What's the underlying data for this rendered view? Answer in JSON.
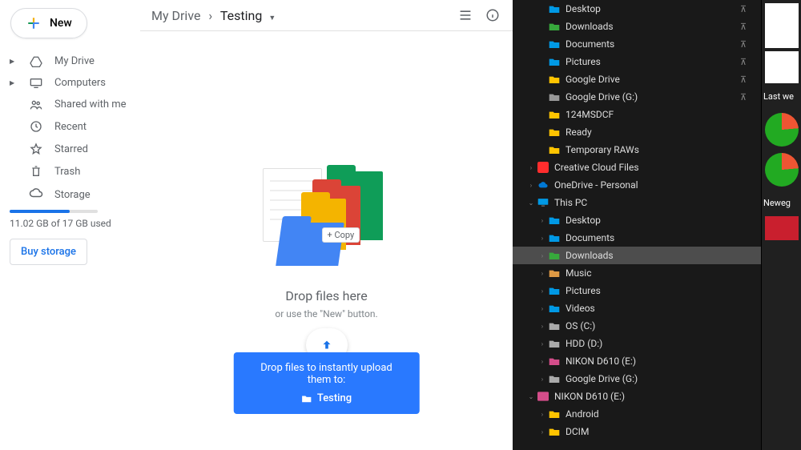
{
  "drive": {
    "new_label": "New",
    "nav": {
      "mydrive": "My Drive",
      "computers": "Computers",
      "shared": "Shared with me",
      "recent": "Recent",
      "starred": "Starred",
      "trash": "Trash"
    },
    "storage": {
      "label": "Storage",
      "used": "11.02 GB of 17 GB used",
      "buy": "Buy storage"
    },
    "breadcrumb": {
      "root": "My Drive",
      "current": "Testing"
    },
    "copy_badge": "+ Copy",
    "drop_title": "Drop files here",
    "drop_sub": "or use the \"New\" button.",
    "toast": {
      "line1": "Drop files to instantly upload them to:",
      "folder": "Testing"
    }
  },
  "explorer": {
    "quick": [
      {
        "label": "Desktop",
        "icon": "#0099e5"
      },
      {
        "label": "Downloads",
        "icon": "#37a93c"
      },
      {
        "label": "Documents",
        "icon": "#0099e5"
      },
      {
        "label": "Pictures",
        "icon": "#0099e5"
      },
      {
        "label": "Google Drive",
        "icon": "#ffc400"
      },
      {
        "label": "Google Drive (G:)",
        "icon": "#999"
      },
      {
        "label": "124MSDCF",
        "icon": "#ffc400"
      },
      {
        "label": "Ready",
        "icon": "#ffc400"
      },
      {
        "label": "Temporary RAWs",
        "icon": "#ffc400"
      }
    ],
    "creative": "Creative Cloud Files",
    "onedrive": "OneDrive - Personal",
    "thispc": "This PC",
    "pc": [
      {
        "label": "Desktop",
        "icon": "#0099e5"
      },
      {
        "label": "Documents",
        "icon": "#0099e5"
      },
      {
        "label": "Downloads",
        "icon": "#37a93c",
        "sel": true
      },
      {
        "label": "Music",
        "icon": "#d94"
      },
      {
        "label": "Pictures",
        "icon": "#0099e5"
      },
      {
        "label": "Videos",
        "icon": "#0099e5"
      },
      {
        "label": "OS (C:)",
        "icon": "#aaa"
      },
      {
        "label": "HDD (D:)",
        "icon": "#aaa"
      },
      {
        "label": "NIKON D610  (E:)",
        "icon": "#d44d8a"
      },
      {
        "label": "Google Drive (G:)",
        "icon": "#aaa"
      }
    ],
    "nikon": "NIKON D610  (E:)",
    "nikon_items": [
      {
        "label": "Android",
        "icon": "#ffc400"
      },
      {
        "label": "DCIM",
        "icon": "#ffc400"
      }
    ]
  },
  "rightpanel": {
    "label1": "Last we",
    "label2": "Neweg"
  }
}
